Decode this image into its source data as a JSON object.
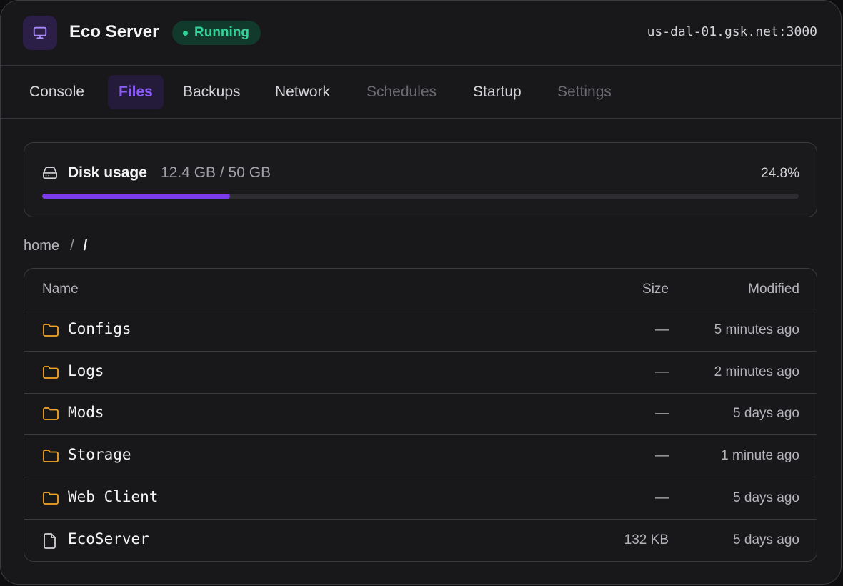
{
  "header": {
    "server_name": "Eco Server",
    "server_icon": "monitor-icon",
    "status": "Running",
    "status_color": "#34d399",
    "address": "us-dal-01.gsk.net:3000"
  },
  "tabs": [
    {
      "label": "Console",
      "state": "normal"
    },
    {
      "label": "Files",
      "state": "active"
    },
    {
      "label": "Backups",
      "state": "normal"
    },
    {
      "label": "Network",
      "state": "normal"
    },
    {
      "label": "Schedules",
      "state": "disabled"
    },
    {
      "label": "Startup",
      "state": "normal"
    },
    {
      "label": "Settings",
      "state": "disabled"
    }
  ],
  "disk": {
    "icon": "hard-drive-icon",
    "label": "Disk usage",
    "amount": "12.4 GB / 50 GB",
    "percent_text": "24.8%",
    "fraction": 0.248,
    "accent": "#7c3aed"
  },
  "breadcrumb": {
    "root": "home",
    "separator": "/",
    "current": "/"
  },
  "table": {
    "columns": {
      "name": "Name",
      "size": "Size",
      "modified": "Modified"
    },
    "rows": [
      {
        "type": "folder",
        "name": "Configs",
        "size": "—",
        "modified": "5 minutes ago"
      },
      {
        "type": "folder",
        "name": "Logs",
        "size": "—",
        "modified": "2 minutes ago"
      },
      {
        "type": "folder",
        "name": "Mods",
        "size": "—",
        "modified": "5 days ago"
      },
      {
        "type": "folder",
        "name": "Storage",
        "size": "—",
        "modified": "1 minute ago"
      },
      {
        "type": "folder",
        "name": "Web Client",
        "size": "—",
        "modified": "5 days ago"
      },
      {
        "type": "file",
        "name": "EcoServer",
        "size": "132 KB",
        "modified": "5 days ago"
      }
    ]
  }
}
